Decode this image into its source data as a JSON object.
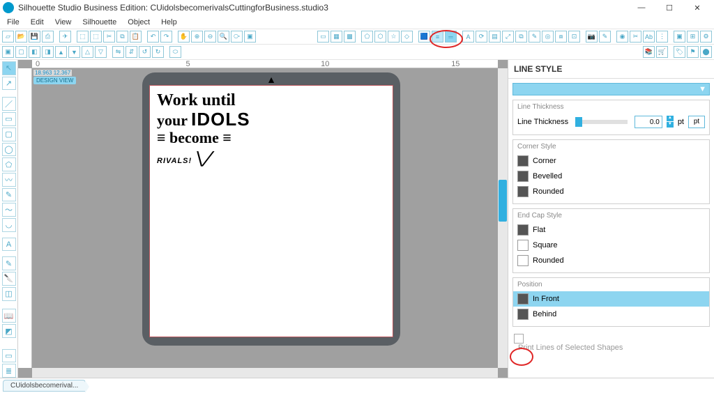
{
  "window": {
    "title": "Silhouette Studio Business Edition: CUidolsbecomerivalsCuttingforBusiness.studio3",
    "buttons": {
      "min": "—",
      "max": "☐",
      "close": "✕"
    }
  },
  "menus": [
    "File",
    "Edit",
    "View",
    "Silhouette",
    "Object",
    "Help"
  ],
  "canvas": {
    "coords": "18.963  12.367",
    "design_view": "DESIGN VIEW",
    "ruler_marks": [
      "0",
      "5",
      "10",
      "15"
    ],
    "art": {
      "l1": "Work until",
      "l2a": "your ",
      "l2b": "IDOLS",
      "l3a": "≡ ",
      "l3b": "become",
      "l3c": " ≡",
      "l4": "RIVALS! "
    }
  },
  "panel": {
    "title": "LINE STYLE",
    "thickness": {
      "hdr": "Line Thickness",
      "label": "Line Thickness",
      "value": "0.0",
      "unit": "pt",
      "unit_btn": "pt"
    },
    "corner": {
      "hdr": "Corner Style",
      "opt1": "Corner",
      "opt2": "Bevelled",
      "opt3": "Rounded"
    },
    "endcap": {
      "hdr": "End Cap Style",
      "opt1": "Flat",
      "opt2": "Square",
      "opt3": "Rounded"
    },
    "position": {
      "hdr": "Position",
      "opt1": "In Front",
      "opt2": "Behind"
    },
    "print_lines": "Print Lines of Selected Shapes"
  },
  "tab": {
    "label": "CUidolsbecomerival..."
  }
}
